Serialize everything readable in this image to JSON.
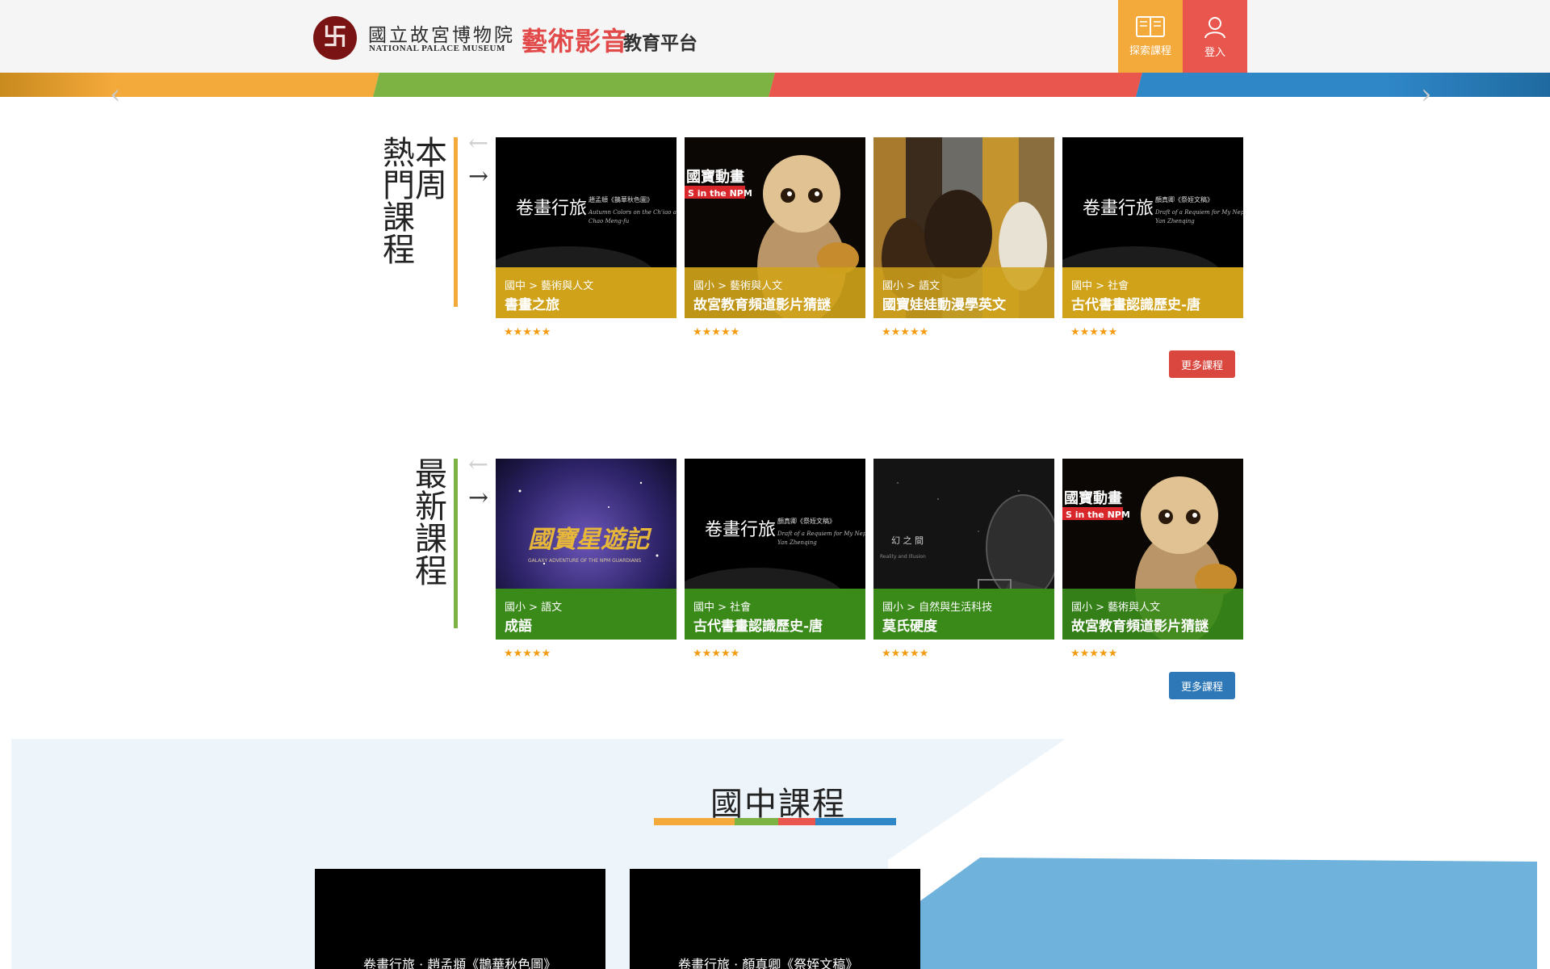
{
  "header": {
    "logo_symbol": "卐",
    "logo_cn": "國立故宮博物院",
    "logo_en": "NATIONAL PALACE MUSEUM",
    "logo_art": "藝術影音",
    "logo_edu": "教育平台",
    "explore_label": "探索課程",
    "login_label": "登入",
    "explore_icon": "book-icon",
    "login_icon": "user-icon",
    "colors": {
      "explore": "#f4a93b",
      "login": "#e8564d"
    }
  },
  "slider": {
    "prev": "‹",
    "next": "›"
  },
  "popular": {
    "title": "本周熱門課程",
    "title_col1": "熱門課程",
    "title_col2": "本周",
    "prev_arrow": "←",
    "next_arrow": "→",
    "accent": "#f4a93b",
    "caption_color": "#cfa21a",
    "more_label": "更多課程",
    "more_color": "#d9473f",
    "courses": [
      {
        "category": "國中 > 藝術與人文",
        "title": "書畫之旅",
        "rating": "★★★★★"
      },
      {
        "category": "國小 > 藝術與人文",
        "title": "故宮教育頻道影片猜謎",
        "rating": "★★★★★"
      },
      {
        "category": "國小 > 語文",
        "title": "國寶娃娃動漫學英文",
        "rating": "★★★★★"
      },
      {
        "category": "國中 > 社會",
        "title": "古代書畫認識歷史-唐",
        "rating": "★★★★★"
      }
    ],
    "thumb_text": {
      "calligraphy_1": "卷畫行旅",
      "calligraphy_1_sub1": "趙孟頫《鵲華秋色圖》",
      "calligraphy_1_sub2": "Autumn Colors on the Ch'iao and",
      "calligraphy_1_sub3": "Chao Meng-fu",
      "doll_logo": "國寶動畫",
      "doll_tag": "S in the NPM",
      "calligraphy_2": "卷畫行旅",
      "calligraphy_2_sub1": "顏真卿《祭姪文稿》",
      "calligraphy_2_sub2": "Draft of a Requiem for My Nephew",
      "calligraphy_2_sub3": "Yan Zhenqing"
    }
  },
  "latest": {
    "title": "最新課程",
    "prev_arrow": "←",
    "next_arrow": "→",
    "accent": "#7cb342",
    "caption_color": "#3a8a1a",
    "more_label": "更多課程",
    "more_color": "#2f78b7",
    "courses": [
      {
        "category": "國小 > 語文",
        "title": "成語",
        "rating": "★★★★★"
      },
      {
        "category": "國中 > 社會",
        "title": "古代書畫認識歷史-唐",
        "rating": "★★★★★"
      },
      {
        "category": "國小 > 自然與生活科技",
        "title": "莫氏硬度",
        "rating": "★★★★★"
      },
      {
        "category": "國小 > 藝術與人文",
        "title": "故宮教育頻道影片猜謎",
        "rating": "★★★★★"
      }
    ],
    "thumb_text": {
      "galaxy": "國寶星遊記",
      "galaxy_sub": "GALAXY ADVENTURE OF THE NPM GUARDIANS",
      "calligraphy": "卷畫行旅",
      "calligraphy_sub1": "顏真卿《祭姪文稿》",
      "calligraphy_sub2": "Draft of a Requiem for My Nephew",
      "calligraphy_sub3": "Yan Zhenqing",
      "illusion": "幻 之 間",
      "illusion_sub": "Reality and Illusion",
      "doll_logo": "國寶動畫",
      "doll_tag": "S in the NPM"
    }
  },
  "junior": {
    "title": "國中課程",
    "bar_colors": [
      "#f4a93b",
      "#7cb342",
      "#e8564d",
      "#2f87c8"
    ],
    "video_text_1": "卷畫行旅 · 趙孟頫《鵲華秋色圖》",
    "video_text_2": "卷畫行旅 · 顏真卿《祭姪文稿》"
  }
}
